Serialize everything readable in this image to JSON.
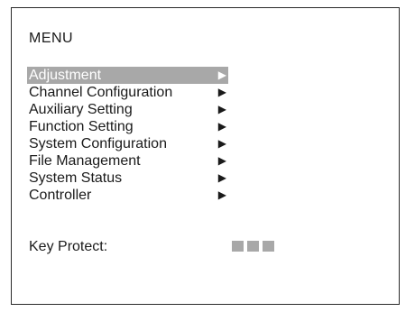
{
  "menu": {
    "title": "MENU",
    "items": [
      {
        "label": "Adjustment",
        "arrow": "▶",
        "selected": true
      },
      {
        "label": "Channel Configuration",
        "arrow": "▶",
        "selected": false
      },
      {
        "label": "Auxiliary Setting",
        "arrow": "▶",
        "selected": false
      },
      {
        "label": "Function Setting",
        "arrow": "▶",
        "selected": false
      },
      {
        "label": "System Configuration",
        "arrow": "▶",
        "selected": false
      },
      {
        "label": "File Management",
        "arrow": "▶",
        "selected": false
      },
      {
        "label": "System Status",
        "arrow": "▶",
        "selected": false
      },
      {
        "label": "Controller",
        "arrow": "▶",
        "selected": false
      }
    ],
    "highlight_color": "#a8a8a8"
  },
  "key_protect": {
    "label": "Key Protect:",
    "indicator_blocks": 3,
    "indicator_color": "#a8a8a8"
  }
}
